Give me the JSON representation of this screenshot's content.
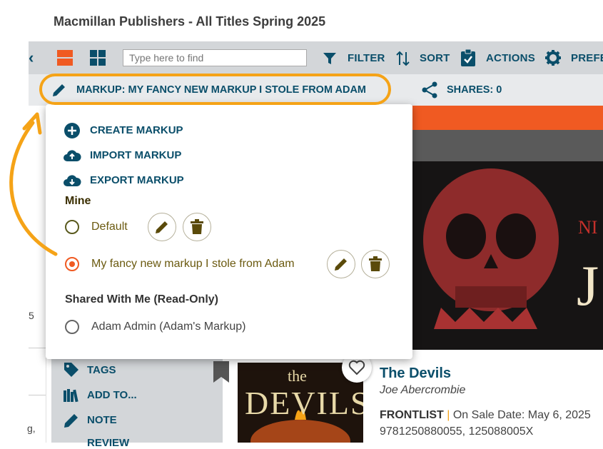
{
  "page_title": "Macmillan Publishers - All Titles Spring 2025",
  "toolbar": {
    "search_placeholder": "Type here to find",
    "filter_label": "FILTER",
    "sort_label": "SORT",
    "actions_label": "ACTIONS",
    "preferences_label": "PREFE"
  },
  "markup_bar": {
    "markup_label": "MARKUP: MY FANCY NEW MARKUP I STOLE FROM ADAM",
    "shares_label": "SHARES: 0"
  },
  "popup": {
    "create_label": "CREATE MARKUP",
    "import_label": "IMPORT MARKUP",
    "export_label": "EXPORT MARKUP",
    "mine_heading": "Mine",
    "mine_options": [
      {
        "label": "Default",
        "selected": false
      },
      {
        "label": "My fancy new markup I stole from Adam",
        "selected": true
      }
    ],
    "shared_heading": "Shared With Me (Read-Only)",
    "shared_options": [
      {
        "label": "Adam Admin (Adam's Markup)",
        "selected": false
      }
    ]
  },
  "side_panel": {
    "items": [
      "TAGS",
      "ADD TO...",
      "NOTE",
      "REVIEW"
    ]
  },
  "book": {
    "title": "The Devils",
    "author": "Joe Abercrombie",
    "frontlist": "FRONTLIST",
    "separator": "|",
    "on_sale": "On Sale Date: May 6, 2025",
    "isbn": "9781250880055, 125088005X",
    "cover_text_1": "the",
    "cover_text_2": "DEVILS"
  },
  "cover_main_text": {
    "letters_top": "NI",
    "letter_big": "J"
  },
  "left_rail_fragments": [
    "5",
    "g,"
  ],
  "colors": {
    "accent": "#f05a22",
    "brand_blue": "#0a4e6a",
    "highlight": "#f5a317",
    "toolbar_bg": "#d3d6d9"
  }
}
